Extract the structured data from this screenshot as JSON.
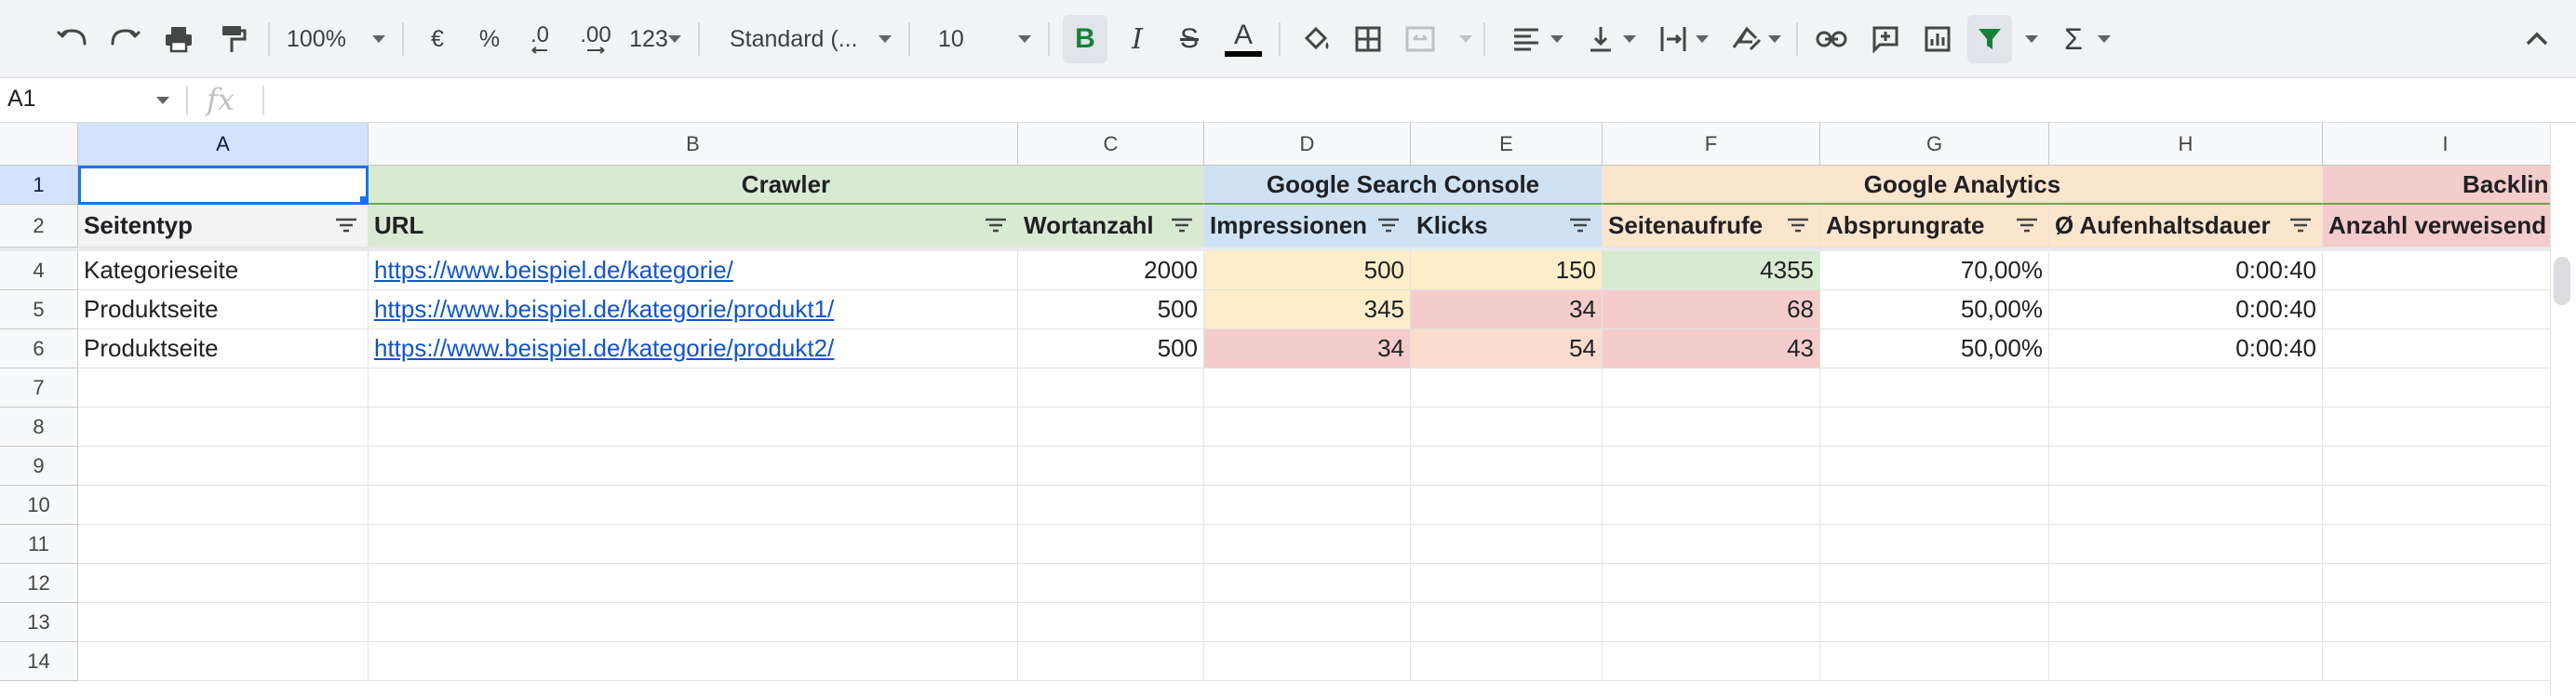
{
  "toolbar": {
    "zoom": "100%",
    "currency_label": "€",
    "percent_label": "%",
    "dec_decrease_label": ".0",
    "dec_increase_label": ".00",
    "more_formats_label": "123",
    "font_family": "Standard (...",
    "font_size": "10",
    "bold_label": "B",
    "italic_label": "I",
    "strike_label": "S",
    "text_color_label": "A",
    "sum_label": "Σ",
    "colors": {
      "active_bg": "#e1e5ea",
      "bold_color": "#188038",
      "filter_color": "#188038"
    }
  },
  "formula_bar": {
    "cell_ref": "A1",
    "fx_label": "fx",
    "content": ""
  },
  "columns": [
    {
      "letter": "A"
    },
    {
      "letter": "B"
    },
    {
      "letter": "C"
    },
    {
      "letter": "D"
    },
    {
      "letter": "E"
    },
    {
      "letter": "F"
    },
    {
      "letter": "G"
    },
    {
      "letter": "H"
    },
    {
      "letter": "I"
    }
  ],
  "row_numbers": [
    "1",
    "2",
    "4",
    "5",
    "6",
    "7",
    "8",
    "9",
    "10",
    "11",
    "12",
    "13",
    "14"
  ],
  "groups": [
    {
      "label": "",
      "color": "#ffffff"
    },
    {
      "label": "Crawler",
      "color": "#d9ead3"
    },
    {
      "label": "Google Search Console",
      "color": "#cfe2f3"
    },
    {
      "label": "Google Analytics",
      "color": "#fce5cd"
    },
    {
      "label": "Backlink",
      "color": "#f4cccc"
    }
  ],
  "headers": [
    {
      "label": "Seitentyp",
      "color": "#f3f3f3"
    },
    {
      "label": "URL",
      "color": "#d9ead3"
    },
    {
      "label": "Wortanzahl",
      "color": "#d9ead3"
    },
    {
      "label": "Impressionen",
      "color": "#cfe2f3"
    },
    {
      "label": "Klicks",
      "color": "#cfe2f3"
    },
    {
      "label": "Seitenaufrufe",
      "color": "#fce5cd"
    },
    {
      "label": "Absprungrate",
      "color": "#fce5cd"
    },
    {
      "label": "Ø Aufenhaltsdauer",
      "color": "#fce5cd"
    },
    {
      "label": "Anzahl verweisend",
      "color": "#f4cccc"
    }
  ],
  "rows": [
    {
      "seitentyp": "Kategorieseite",
      "url": "https://www.beispiel.de/kategorie/",
      "wortanzahl": "2000",
      "impressionen": "500",
      "klicks": "150",
      "seitenaufrufe": "4355",
      "absprungrate": "70,00%",
      "aufenthaltsdauer": "0:00:40",
      "verweisend": ""
    },
    {
      "seitentyp": "Produktseite",
      "url": "https://www.beispiel.de/kategorie/produkt1/",
      "wortanzahl": "500",
      "impressionen": "345",
      "klicks": "34",
      "seitenaufrufe": "68",
      "absprungrate": "50,00%",
      "aufenthaltsdauer": "0:00:40",
      "verweisend": ""
    },
    {
      "seitentyp": "Produktseite",
      "url": "https://www.beispiel.de/kategorie/produkt2/",
      "wortanzahl": "500",
      "impressionen": "34",
      "klicks": "54",
      "seitenaufrufe": "43",
      "absprungrate": "50,00%",
      "aufenthaltsdauer": "0:00:40",
      "verweisend": ""
    }
  ],
  "cell_colors": {
    "yellow": "#fce8c0",
    "red": "#f4cccc",
    "peach": "#f9d8c4",
    "green": "#d9ead3",
    "row_colors": [
      [
        "",
        "",
        "",
        "#fdeec9",
        "#fdeec9",
        "#d9ead3",
        "",
        "",
        ""
      ],
      [
        "",
        "",
        "",
        "#fdeec9",
        "#f4cccc",
        "#f4cccc",
        "",
        "",
        ""
      ],
      [
        "",
        "",
        "",
        "#f4cccc",
        "#f9dccc",
        "#f4cccc",
        "",
        "",
        ""
      ]
    ]
  }
}
